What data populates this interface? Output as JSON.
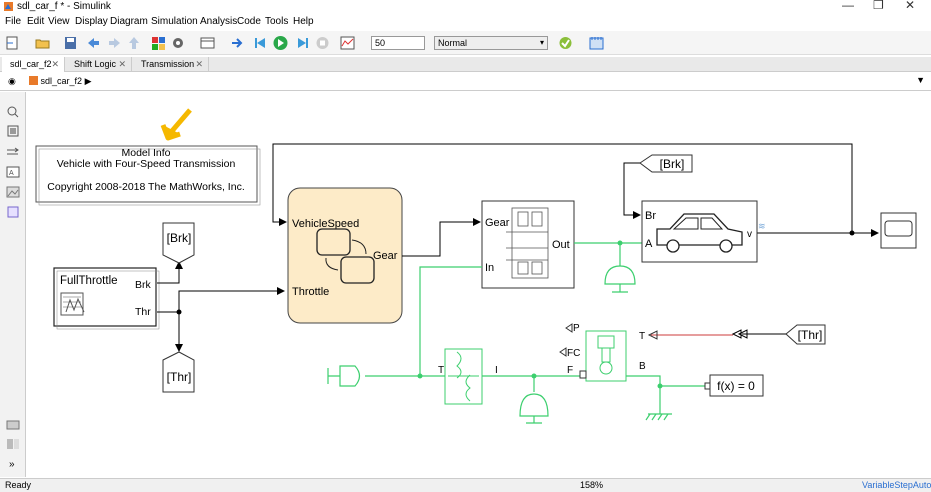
{
  "window": {
    "title": "sdl_car_f * - Simulink",
    "min_glyph": "—",
    "restore_glyph": "❐",
    "close_glyph": "✕"
  },
  "menu": [
    "File",
    "Edit",
    "View",
    "Display",
    "Diagram",
    "Simulation",
    "Analysis",
    "Code",
    "Tools",
    "Help"
  ],
  "toolbar": {
    "stop_time": "50",
    "sim_mode": "Normal"
  },
  "tabs": [
    {
      "label": "sdl_car_f2",
      "active": true
    },
    {
      "label": "Shift Logic",
      "active": false
    },
    {
      "label": "Transmission",
      "active": false
    }
  ],
  "breadcrumb": {
    "model": "sdl_car_f2",
    "arrow": "▶"
  },
  "model_info": {
    "line1": "Model Info",
    "line2": "Vehicle with Four-Speed Transmission",
    "line3": "Copyright 2008-2018 The MathWorks, Inc."
  },
  "blocks": {
    "full_throttle": {
      "name": "FullThrottle",
      "out1": "Brk",
      "out2": "Thr"
    },
    "goto_brk": "[Brk]",
    "goto_thr": "[Thr]",
    "from_brk": "[Brk]",
    "from_thr": "[Thr]",
    "shift_logic": {
      "in1": "VehicleSpeed",
      "in2": "Throttle",
      "out": "Gear"
    },
    "transmission": {
      "in1": "Gear",
      "in2": "In",
      "out": "Out"
    },
    "vehicle": {
      "in1": "Br",
      "in2": "A",
      "out": "v"
    },
    "engine": {
      "p": "P",
      "fc": "FC",
      "f": "F",
      "t": "T",
      "b": "B"
    },
    "torque_conv": {
      "t": "T",
      "i": "I"
    },
    "solver": "f(x) = 0"
  },
  "status": {
    "left": "Ready",
    "zoom": "158%",
    "solver": "VariableStepAuto"
  },
  "colors": {
    "physical_line": "#3ccf6e",
    "signal_line": "#000000",
    "chart_fill": "#fdebc8",
    "arrow_annotation": "#f5b800",
    "link_red": "#cc3b3b"
  }
}
